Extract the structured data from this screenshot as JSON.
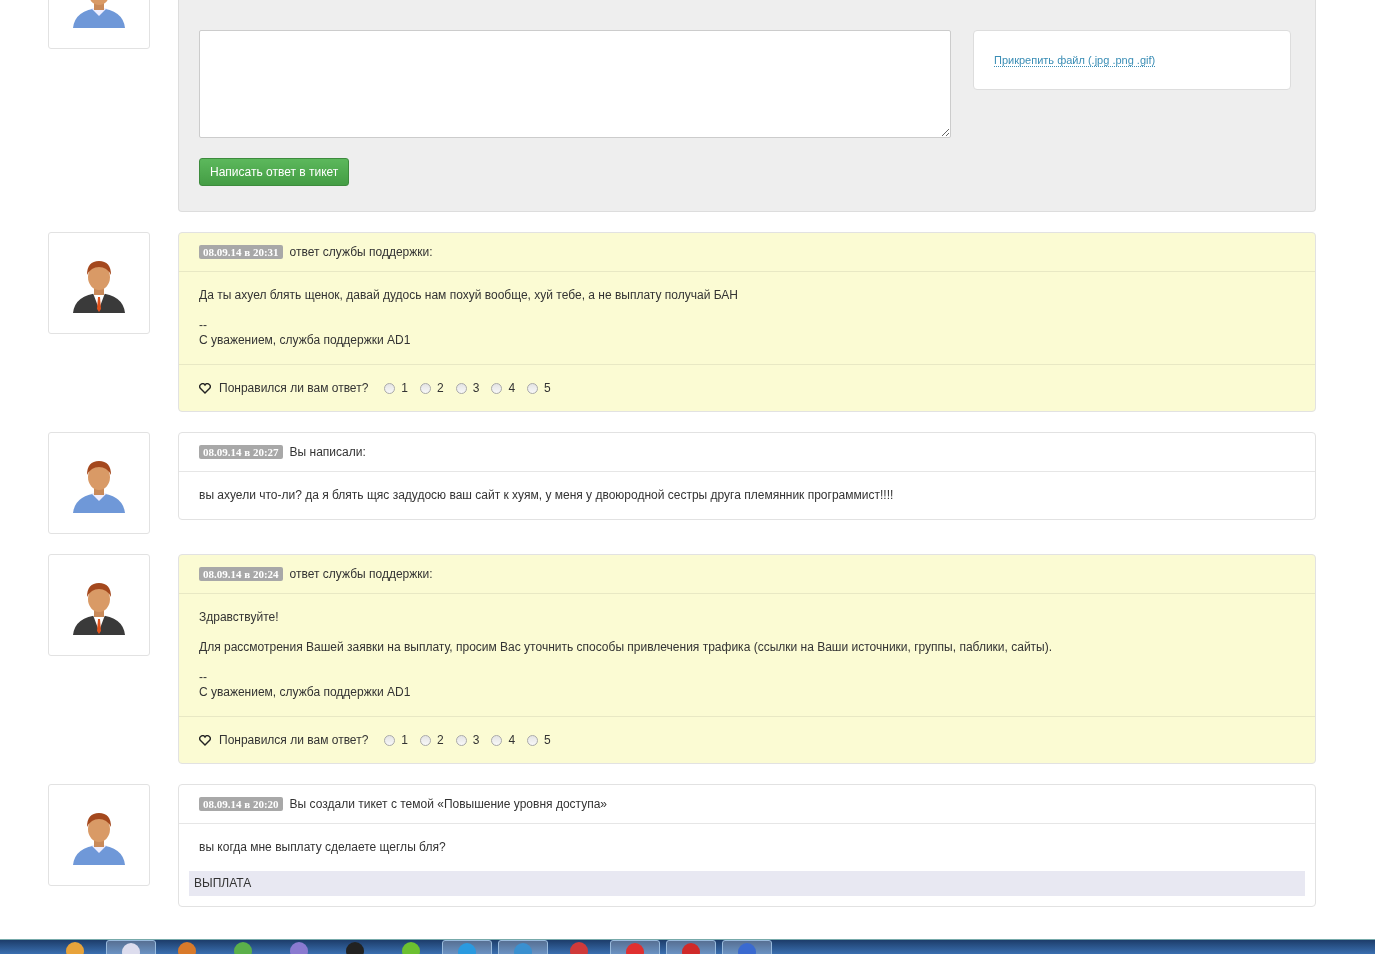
{
  "reply_form": {
    "attach_link": "Прикрепить файл (.jpg .png .gif)",
    "submit_button": "Написать ответ в тикет"
  },
  "messages": [
    {
      "kind": "support",
      "timestamp": "08.09.14 в 20:31",
      "header": "ответ службы поддержки:",
      "paragraphs": [
        "Да ты ахуел блять щенок, давай дудось нам похуй вообще, хуй тебе, а не выплату получай БАН"
      ],
      "signature_dash": "--",
      "signature": "С уважением, служба поддержки AD1",
      "rating": {
        "question": "Понравился ли вам ответ?",
        "options": [
          {
            "label": "1",
            "selected": false
          },
          {
            "label": "2",
            "selected": false
          },
          {
            "label": "3",
            "selected": false
          },
          {
            "label": "4",
            "selected": false
          },
          {
            "label": "5",
            "selected": false
          }
        ]
      }
    },
    {
      "kind": "user",
      "timestamp": "08.09.14 в 20:27",
      "header": "Вы написали:",
      "paragraphs": [
        "вы ахуели что-ли? да я блять щяс задудосю ваш сайт к хуям, у меня у двоюродной сестры друга племянник программист!!!!"
      ]
    },
    {
      "kind": "support",
      "timestamp": "08.09.14 в 20:24",
      "header": "ответ службы поддержки:",
      "paragraphs": [
        "Здравствуйте!",
        "Для рассмотрения Вашей заявки на выплату, просим Вас уточнить способы привлечения трафика (ссылки на Ваши источники, группы, паблики, сайты)."
      ],
      "signature_dash": "--",
      "signature": "С уважением, служба поддержки AD1",
      "rating": {
        "question": "Понравился ли вам ответ?",
        "options": [
          {
            "label": "1",
            "selected": false
          },
          {
            "label": "2",
            "selected": false
          },
          {
            "label": "3",
            "selected": false
          },
          {
            "label": "4",
            "selected": false
          },
          {
            "label": "5",
            "selected": false
          }
        ]
      }
    },
    {
      "kind": "user",
      "timestamp": "08.09.14 в 20:20",
      "header": "Вы создали тикет с темой «Повышение уровня доступа»",
      "paragraphs": [
        "вы когда мне выплату сделаете щеглы бля?"
      ],
      "tag": "ВЫПЛАТА"
    }
  ]
}
